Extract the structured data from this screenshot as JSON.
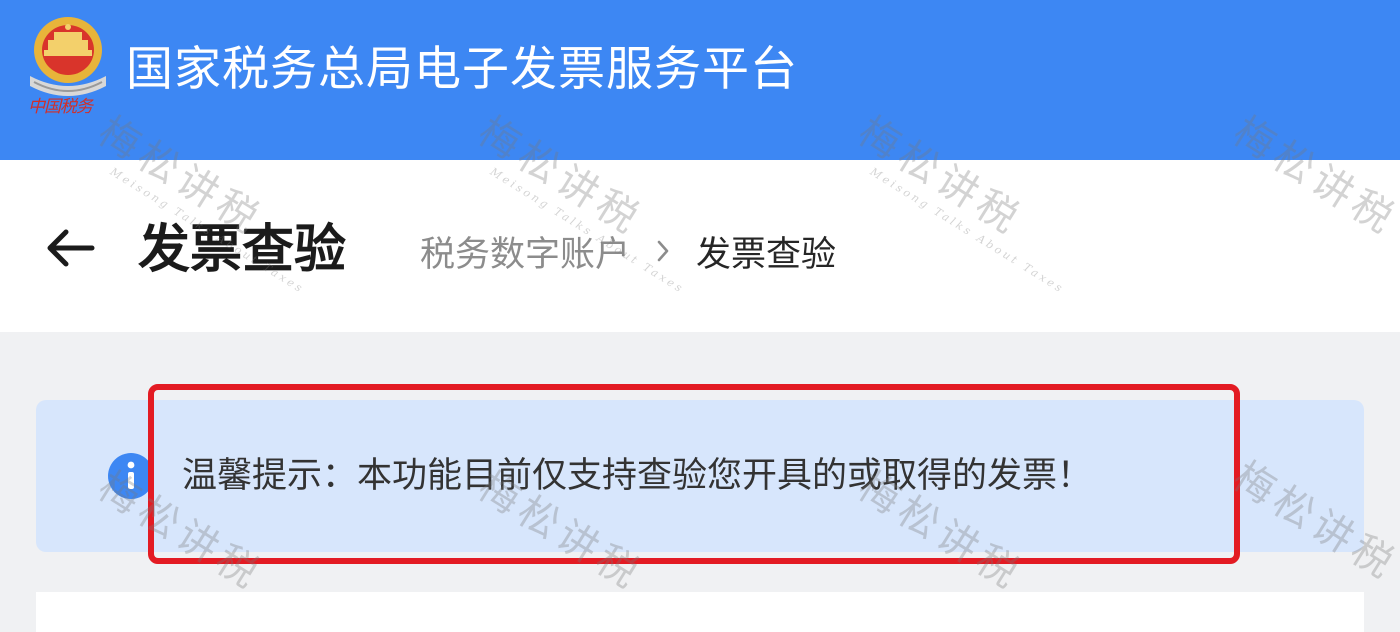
{
  "header": {
    "site_title": "国家税务总局电子发票服务平台",
    "emblem_caption": "中国税务",
    "background_color": "#3d87f3"
  },
  "page": {
    "back_icon": "arrow-left-icon",
    "title": "发票查验",
    "breadcrumb": {
      "parent": "税务数字账户",
      "separator_icon": "chevron-right-icon",
      "current": "发票查验"
    }
  },
  "notice": {
    "icon": "info-icon",
    "text": "温馨提示：本功能目前仅支持查验您开具的或取得的发票！",
    "background_color": "#d7e6fc",
    "highlight_color": "#e31b23"
  },
  "watermark": {
    "text": "梅松讲税",
    "subtext": "Meisong Talks About Taxes"
  }
}
